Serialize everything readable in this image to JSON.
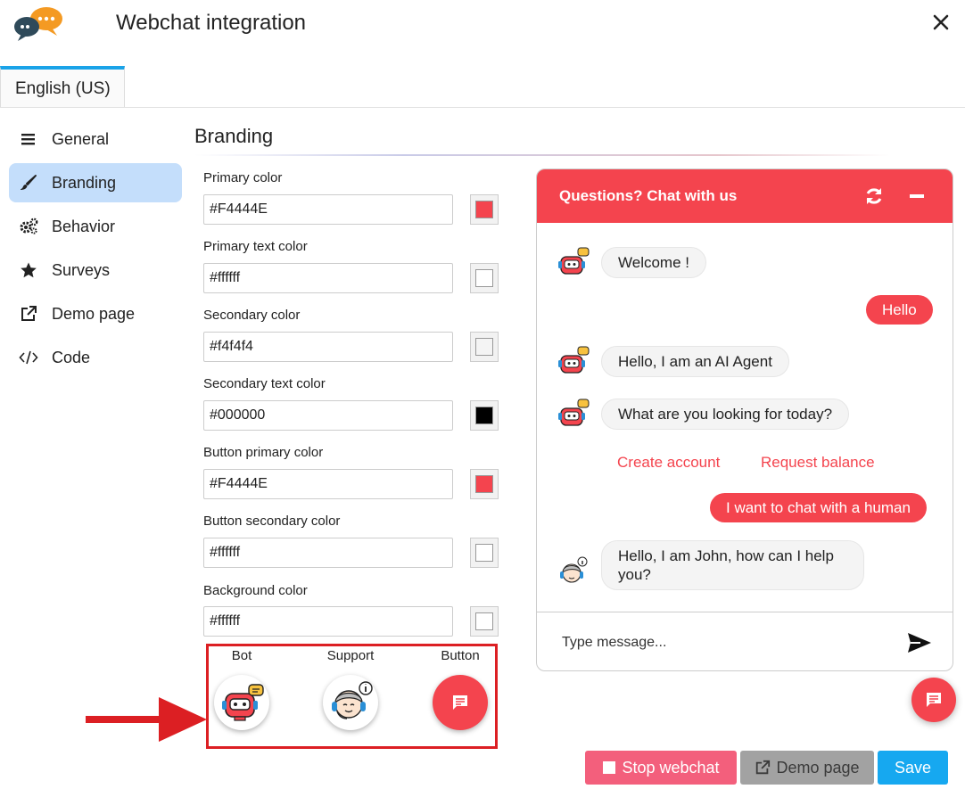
{
  "header": {
    "title": "Webchat integration"
  },
  "language_tab": {
    "label": "English (US)"
  },
  "sidebar": {
    "items": [
      {
        "label": "General",
        "icon": "bars-icon",
        "active": false
      },
      {
        "label": "Branding",
        "icon": "brush-icon",
        "active": true
      },
      {
        "label": "Behavior",
        "icon": "gears-icon",
        "active": false
      },
      {
        "label": "Surveys",
        "icon": "star-icon",
        "active": false
      },
      {
        "label": "Demo page",
        "icon": "external-link-icon",
        "active": false
      },
      {
        "label": "Code",
        "icon": "code-icon",
        "active": false
      }
    ]
  },
  "branding": {
    "title": "Branding",
    "fields": [
      {
        "label": "Primary color",
        "value": "#F4444E",
        "swatch": "#F4444E"
      },
      {
        "label": "Primary text color",
        "value": "#ffffff",
        "swatch": "#ffffff"
      },
      {
        "label": "Secondary color",
        "value": "#f4f4f4",
        "swatch": "#f4f4f4"
      },
      {
        "label": "Secondary text color",
        "value": "#000000",
        "swatch": "#000000"
      },
      {
        "label": "Button primary color",
        "value": "#F4444E",
        "swatch": "#F4444E"
      },
      {
        "label": "Button secondary color",
        "value": "#ffffff",
        "swatch": "#ffffff"
      },
      {
        "label": "Background color",
        "value": "#ffffff",
        "swatch": "#ffffff"
      }
    ],
    "avatars": {
      "bot_label": "Bot",
      "support_label": "Support",
      "button_label": "Button"
    }
  },
  "chat": {
    "title": "Questions? Chat with us",
    "messages": [
      {
        "from": "bot",
        "text": "Welcome !"
      },
      {
        "from": "user",
        "text": "Hello"
      },
      {
        "from": "bot",
        "text": "Hello, I am an AI Agent"
      },
      {
        "from": "bot",
        "text": "What are you looking for today?"
      },
      {
        "from": "user",
        "text": "I want to chat with a human"
      },
      {
        "from": "support",
        "text": "Hello, I am John, how can I help you?"
      }
    ],
    "quick_replies": [
      "Create account",
      "Request balance"
    ],
    "input_placeholder": "Type message..."
  },
  "footer": {
    "stop_label": "Stop webchat",
    "demo_label": "Demo page",
    "save_label": "Save"
  },
  "colors": {
    "primary": "#F4444E",
    "accent_blue": "#16a8f0",
    "sidebar_active": "#c4defb",
    "annotation_red": "#dc1f23"
  }
}
